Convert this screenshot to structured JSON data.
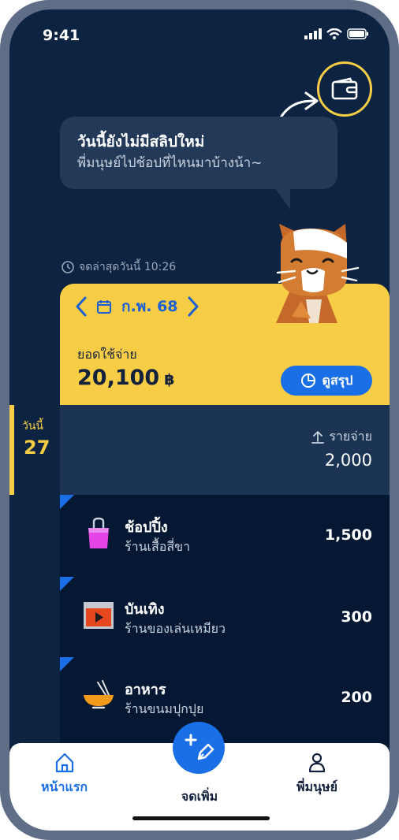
{
  "status": {
    "time": "9:41"
  },
  "bubble": {
    "title": "วันนี้ยังไม่มีสลิปใหม่",
    "subtitle": "พี่มนุษย์ไปช้อปที่ไหนมาบ้างน้า~"
  },
  "last_recorded": "จดล่าสุดวันนี้ 10:26",
  "card": {
    "month": "ก.พ. 68",
    "spend_label": "ยอดใช้จ่าย",
    "spend_amount": "20,100",
    "currency": "฿",
    "summary_button": "ดูสรุป"
  },
  "day": {
    "label": "วันนี้",
    "number": "27"
  },
  "expense": {
    "label": "รายจ่าย",
    "total": "2,000"
  },
  "transactions": [
    {
      "title": "ช้อปปิ้ง",
      "subtitle": "ร้านเสื้อสี่ขา",
      "amount": "1,500",
      "icon": "shopping-bag-icon"
    },
    {
      "title": "บันเทิง",
      "subtitle": "ร้านของเล่นเหมียว",
      "amount": "300",
      "icon": "video-play-icon"
    },
    {
      "title": "อาหาร",
      "subtitle": "ร้านขนมปุกปุย",
      "amount": "200",
      "icon": "food-bowl-icon"
    }
  ],
  "nav": {
    "home": "หน้าแรก",
    "add": "จดเพิ่ม",
    "profile": "พี่มนุษย์"
  },
  "colors": {
    "accent_yellow": "#f6cd44",
    "accent_blue": "#1a6fe6",
    "background": "#0c2341"
  }
}
